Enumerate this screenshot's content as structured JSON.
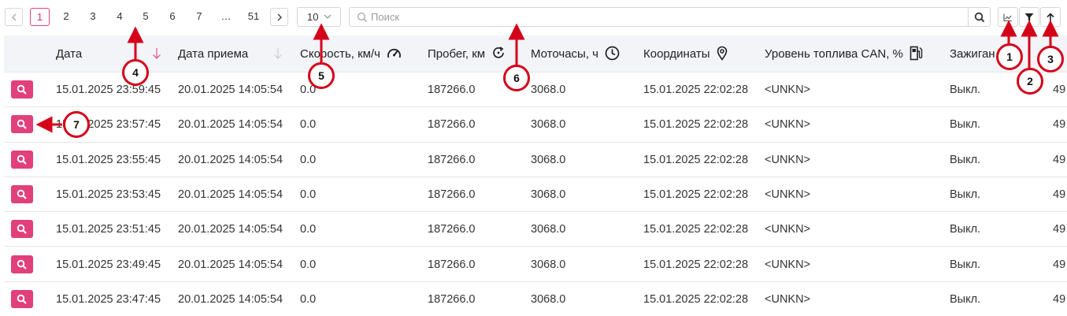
{
  "pagination": {
    "prev_icon": "chevron-left-icon",
    "next_icon": "chevron-right-icon",
    "pages": [
      "1",
      "2",
      "3",
      "4",
      "5",
      "6",
      "7",
      "…",
      "51"
    ],
    "active": "1"
  },
  "per_page": {
    "value": "10",
    "icon": "chevron-down-icon"
  },
  "search": {
    "placeholder": "Поиск",
    "value": "",
    "icon": "search-icon"
  },
  "tools": {
    "chart_icon": "chart-icon",
    "filter_icon": "filter-icon",
    "up_icon": "arrow-up-icon"
  },
  "columns": [
    {
      "label": "Дата",
      "icon": "sort-down-icon",
      "icon_color": "#e2407a"
    },
    {
      "label": "Дата приема",
      "icon": "sort-down-icon",
      "icon_color": "#c8c8c8"
    },
    {
      "label": "Скорость, км/ч",
      "icon": "speedometer-icon"
    },
    {
      "label": "Пробег, км",
      "icon": "odometer-icon"
    },
    {
      "label": "Моточасы, ч",
      "icon": "clock-icon"
    },
    {
      "label": "Координаты",
      "icon": "location-pin-icon"
    },
    {
      "label": "Уровень топлива CAN, %",
      "icon": "fuel-icon"
    },
    {
      "label": "Зажиган",
      "icon": ""
    }
  ],
  "rows": [
    {
      "date": "15.01.2025 23:59:45",
      "received": "20.01.2025 14:05:54",
      "speed": "0.0",
      "mileage": "187266.0",
      "motohours": "3068.0",
      "coords": "15.01.2025 22:02:28",
      "fuel": "<UNKN>",
      "ignition": "Выкл.",
      "extra": "49"
    },
    {
      "date": "15.01.2025 23:57:45",
      "received": "20.01.2025 14:05:54",
      "speed": "0.0",
      "mileage": "187266.0",
      "motohours": "3068.0",
      "coords": "15.01.2025 22:02:28",
      "fuel": "<UNKN>",
      "ignition": "Выкл.",
      "extra": "49"
    },
    {
      "date": "15.01.2025 23:55:45",
      "received": "20.01.2025 14:05:54",
      "speed": "0.0",
      "mileage": "187266.0",
      "motohours": "3068.0",
      "coords": "15.01.2025 22:02:28",
      "fuel": "<UNKN>",
      "ignition": "Выкл.",
      "extra": "49"
    },
    {
      "date": "15.01.2025 23:53:45",
      "received": "20.01.2025 14:05:54",
      "speed": "0.0",
      "mileage": "187266.0",
      "motohours": "3068.0",
      "coords": "15.01.2025 22:02:28",
      "fuel": "<UNKN>",
      "ignition": "Выкл.",
      "extra": "49"
    },
    {
      "date": "15.01.2025 23:51:45",
      "received": "20.01.2025 14:05:54",
      "speed": "0.0",
      "mileage": "187266.0",
      "motohours": "3068.0",
      "coords": "15.01.2025 22:02:28",
      "fuel": "<UNKN>",
      "ignition": "Выкл.",
      "extra": "49"
    },
    {
      "date": "15.01.2025 23:49:45",
      "received": "20.01.2025 14:05:54",
      "speed": "0.0",
      "mileage": "187266.0",
      "motohours": "3068.0",
      "coords": "15.01.2025 22:02:28",
      "fuel": "<UNKN>",
      "ignition": "Выкл.",
      "extra": "49"
    },
    {
      "date": "15.01.2025 23:47:45",
      "received": "20.01.2025 14:05:54",
      "speed": "0.0",
      "mileage": "187266.0",
      "motohours": "3068.0",
      "coords": "15.01.2025 22:02:28",
      "fuel": "<UNKN>",
      "ignition": "Выкл.",
      "extra": "49"
    }
  ],
  "row_action_icon": "search-icon",
  "annotations": [
    "1",
    "2",
    "3",
    "4",
    "5",
    "6",
    "7"
  ],
  "colors": {
    "accent": "#e2407a",
    "annotation": "#d4001a",
    "header_bg": "#f3f4f7",
    "border": "#e4e6ea"
  }
}
